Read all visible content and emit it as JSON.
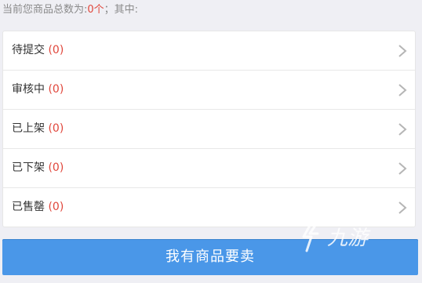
{
  "summary": {
    "prefix": "当前您商品总数为:",
    "count": "0个",
    "suffix": "；其中:"
  },
  "status_list": [
    {
      "label": "待提交",
      "count": "(0)"
    },
    {
      "label": "审核中",
      "count": "(0)"
    },
    {
      "label": "已上架",
      "count": "(0)"
    },
    {
      "label": "已下架",
      "count": "(0)"
    },
    {
      "label": "已售罄",
      "count": "(0)"
    }
  ],
  "sell_button": {
    "label": "我有商品要卖"
  },
  "watermark": {
    "text": "九游"
  },
  "colors": {
    "accent_red": "#e0463b",
    "button_blue": "#4a97e8",
    "background": "#efeff4"
  },
  "icons": {
    "row_arrow": "chevron-right-icon",
    "logo": "jiuyou-logo"
  }
}
